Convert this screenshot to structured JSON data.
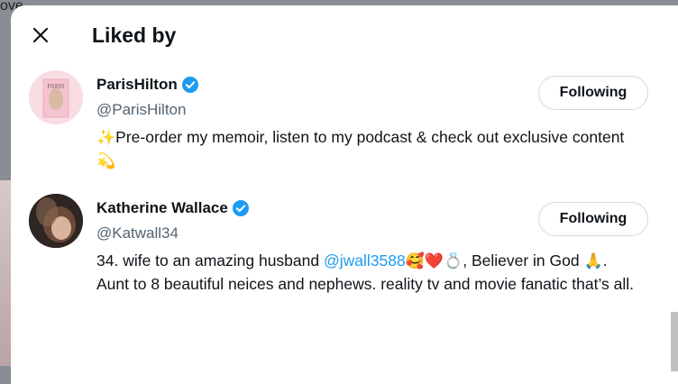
{
  "backdrop": {
    "text": "ove"
  },
  "modal": {
    "title": "Liked by"
  },
  "users": [
    {
      "name": "ParisHilton",
      "handle": "@ParisHilton",
      "button_label": "Following",
      "bio_lead": "✨",
      "bio_text": "Pre-order my memoir, listen to my podcast & check out exclusive content",
      "bio_trail": "💫",
      "avatar_text": "PARIS"
    },
    {
      "name": "Katherine Wallace",
      "handle": "@Katwall34",
      "button_label": "Following",
      "bio_part1": "34. wife to an amazing husband ",
      "bio_link": "@jwall3588",
      "bio_emoji1": "🥰❤️💍",
      "bio_part2": ", Believer in God ",
      "bio_emoji2": "🙏",
      "bio_part3": ". Aunt to 8 beautiful neices and nephews. reality tv and movie fanatic that’s all."
    }
  ],
  "colors": {
    "accent": "#1d9bf0",
    "text": "#0f1419",
    "muted": "#536471"
  }
}
